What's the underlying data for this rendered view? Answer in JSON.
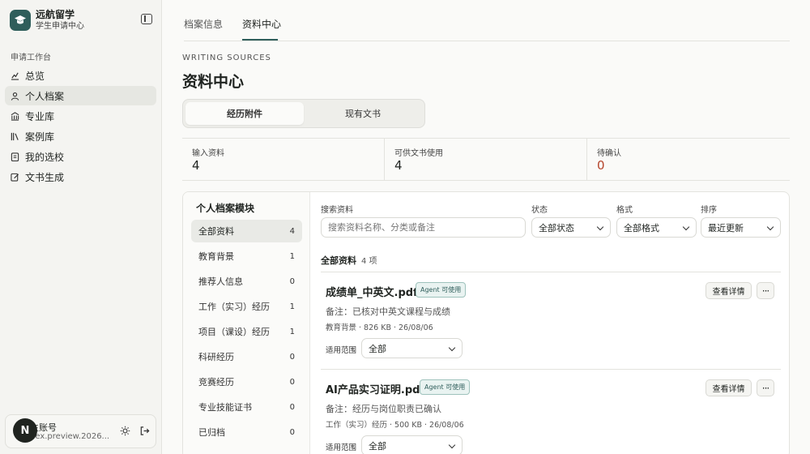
{
  "brand": {
    "title": "远航留学",
    "subtitle": "学生申请中心"
  },
  "nav": {
    "section": "申请工作台",
    "items": [
      {
        "label": "总览",
        "icon": "chart-icon"
      },
      {
        "label": "个人档案",
        "icon": "user-icon",
        "active": true
      },
      {
        "label": "专业库",
        "icon": "building-icon"
      },
      {
        "label": "案例库",
        "icon": "books-icon"
      },
      {
        "label": "我的选校",
        "icon": "clipboard-icon"
      },
      {
        "label": "文书生成",
        "icon": "edit-icon"
      }
    ]
  },
  "account": {
    "initial": "N",
    "name": "生账号",
    "email": "dex.preview.2026..."
  },
  "top_tabs": [
    "档案信息",
    "资料中心"
  ],
  "page": {
    "eyebrow": "WRITING SOURCES",
    "title": "资料中心"
  },
  "segments": [
    "经历附件",
    "现有文书"
  ],
  "stats": [
    {
      "label": "输入资料",
      "value": "4"
    },
    {
      "label": "可供文书使用",
      "value": "4"
    },
    {
      "label": "待确认",
      "value": "0"
    }
  ],
  "modules": {
    "title": "个人档案模块",
    "items": [
      {
        "label": "全部资料",
        "count": "4"
      },
      {
        "label": "教育背景",
        "count": "1"
      },
      {
        "label": "推荐人信息",
        "count": "0"
      },
      {
        "label": "工作（实习）经历",
        "count": "1"
      },
      {
        "label": "项目（课设）经历",
        "count": "1"
      },
      {
        "label": "科研经历",
        "count": "0"
      },
      {
        "label": "竞赛经历",
        "count": "0"
      },
      {
        "label": "专业技能证书",
        "count": "0"
      },
      {
        "label": "已归档",
        "count": "0"
      }
    ]
  },
  "filters": {
    "search_label": "搜索资料",
    "search_placeholder": "搜索资料名称、分类或备注",
    "status_label": "状态",
    "status_value": "全部状态",
    "format_label": "格式",
    "format_value": "全部格式",
    "sort_label": "排序",
    "sort_value": "最近更新"
  },
  "list": {
    "title": "全部资料",
    "count": "4 项"
  },
  "files": [
    {
      "name": "成绩单_中英文.pdf",
      "badge": "Agent 可使用",
      "note": "备注：已核对中英文课程与成绩",
      "meta": "教育背景  ·  826 KB  ·  26/08/06",
      "scope_label": "适用范围",
      "scope_value": "全部",
      "detail": "查看详情",
      "more": "···"
    },
    {
      "name": "AI产品实习证明.pdf",
      "badge": "Agent 可使用",
      "note": "备注：经历与岗位职责已确认",
      "meta": "工作（实习）经历  ·  500 KB  ·  26/08/06",
      "scope_label": "适用范围",
      "scope_value": "全部",
      "detail": "查看详情",
      "more": "···"
    }
  ],
  "colors": {
    "accent": "#2f5e5b",
    "warn": "#b5452c",
    "sidebar_bg": "#f4f4f1"
  }
}
